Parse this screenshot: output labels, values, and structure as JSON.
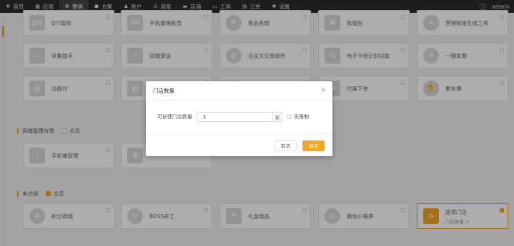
{
  "nav": {
    "items": [
      {
        "icon": "❖",
        "label": "首页"
      },
      {
        "icon": "▦",
        "label": "应用"
      },
      {
        "icon": "✿",
        "label": "营销",
        "active": true
      },
      {
        "icon": "☗",
        "label": "方案"
      },
      {
        "icon": "♟",
        "label": "账户"
      },
      {
        "icon": "♙",
        "label": "商家"
      },
      {
        "icon": "▬",
        "label": "店铺"
      },
      {
        "icon": "▭",
        "label": "工具"
      },
      {
        "icon": "▤",
        "label": "订单"
      },
      {
        "icon": "✺",
        "label": "设置"
      }
    ],
    "user": "admin",
    "info_icon": "ⓘ"
  },
  "rows": {
    "row1": [
      {
        "icon": "DIY",
        "label": "DIY装修"
      },
      {
        "icon": "⌨",
        "label": "手机端销售员"
      },
      {
        "icon": "❀",
        "label": "售后系统"
      },
      {
        "icon": "▣",
        "label": "收银台"
      },
      {
        "icon": "∞",
        "label": "营销链接生成工具"
      }
    ],
    "row2": [
      {
        "icon": "▭",
        "label": "采集助手"
      },
      {
        "icon": "✂",
        "label": "同城速送"
      },
      {
        "icon": "◍",
        "label": "自定义交易组件"
      },
      {
        "icon": "▤",
        "label": "电子卡密识别功能"
      },
      {
        "icon": "⊙",
        "label": "一键发圈"
      }
    ],
    "row3": [
      {
        "icon": "付",
        "label": "当面付"
      },
      {
        "icon": "约",
        "label": ""
      },
      {
        "icon": "",
        "label": ""
      },
      {
        "icon": "▣",
        "label": "代客下单"
      },
      {
        "icon": "✋",
        "label": "聚水潭"
      }
    ]
  },
  "section_mall": {
    "title": "商城管理分类",
    "select_all": "全选",
    "cards": [
      {
        "icon": "▯",
        "label": "手机端管理"
      },
      {
        "icon": "▦",
        "label": ""
      }
    ]
  },
  "section_ungrouped": {
    "title": "未分组",
    "select_all": "全选",
    "cards": [
      {
        "icon": "◉",
        "label": "积分商城"
      },
      {
        "icon": "⛁",
        "label": "BOSS开工"
      },
      {
        "icon": "⚑",
        "label": "礼盒商品"
      },
      {
        "icon": "◎",
        "label": "微信小程序"
      },
      {
        "icon": "⌂",
        "label": "连锁门店",
        "sub": "门店数量 >",
        "selected": true
      }
    ]
  },
  "modal": {
    "title": "门店数量",
    "close": "×",
    "field_label": "可创建门店数量",
    "field_value": "1",
    "unit": "家",
    "unlimited": "无限制",
    "cancel": "取消",
    "confirm": "确定"
  }
}
